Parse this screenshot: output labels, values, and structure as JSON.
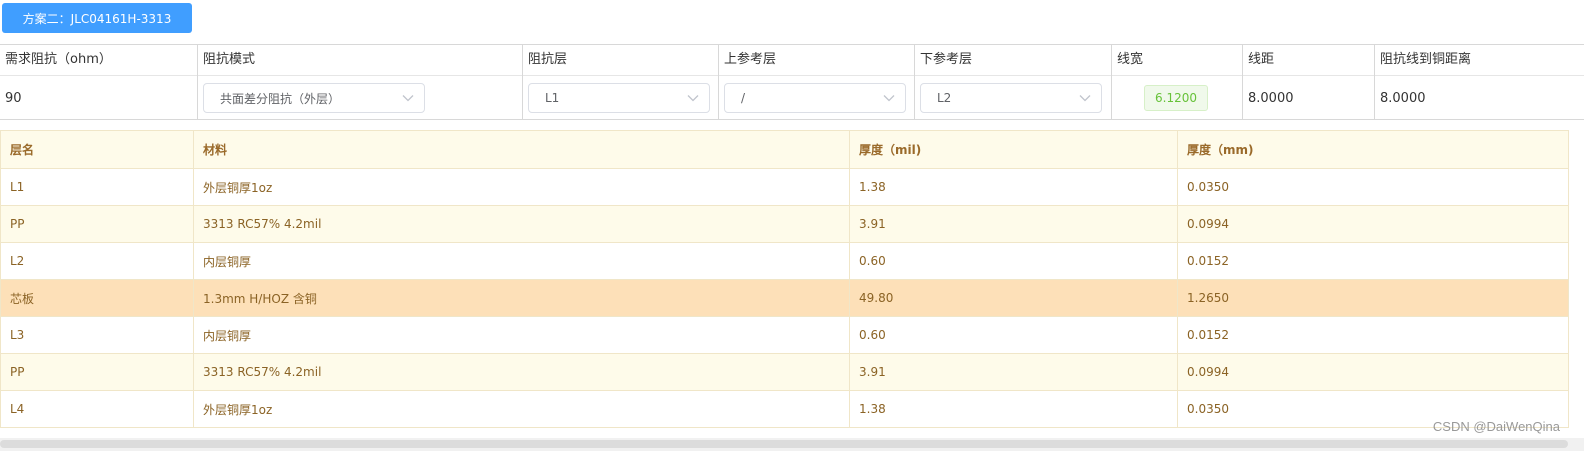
{
  "plan_button": {
    "label": "方案二：JLC04161H-3313"
  },
  "impedance": {
    "headers": [
      "需求阻抗（ohm）",
      "阻抗模式",
      "阻抗层",
      "上参考层",
      "下参考层",
      "线宽",
      "线距",
      "阻抗线到铜距离"
    ],
    "required_impedance": "90",
    "mode": "共面差分阻抗（外层）",
    "impedance_layer": "L1",
    "top_reference": "/",
    "bottom_reference": "L2",
    "line_width": "6.1200",
    "line_spacing": "8.0000",
    "copper_distance": "8.0000"
  },
  "stackup": {
    "headers": [
      "层名",
      "材料",
      "厚度（mil)",
      "厚度（mm)"
    ],
    "rows": [
      [
        "L1",
        "外层铜厚1oz",
        "1.38",
        "0.0350"
      ],
      [
        "PP",
        "3313 RC57% 4.2mil",
        "3.91",
        "0.0994"
      ],
      [
        "L2",
        "内层铜厚",
        "0.60",
        "0.0152"
      ],
      [
        "芯板",
        "1.3mm H/HOZ 含铜",
        "49.80",
        "1.2650"
      ],
      [
        "L3",
        "内层铜厚",
        "0.60",
        "0.0152"
      ],
      [
        "PP",
        "3313 RC57% 4.2mil",
        "3.91",
        "0.0994"
      ],
      [
        "L4",
        "外层铜厚1oz",
        "1.38",
        "0.0350"
      ]
    ]
  },
  "colors": {
    "primary": "#409eff",
    "row_cream": "#fefbea",
    "row_core": "#fde0b8",
    "tag_green": "#67c23a"
  },
  "watermark": "CSDN @DaiWenQina"
}
